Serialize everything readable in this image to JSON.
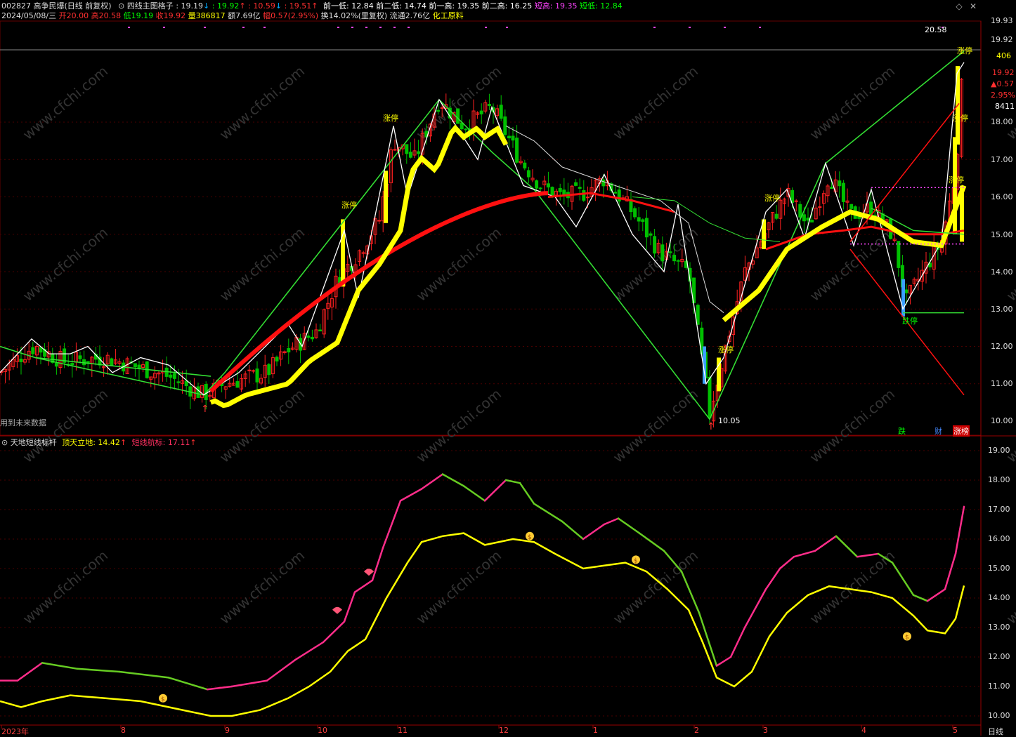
{
  "header1": {
    "code": "002827",
    "name": "高争民爆",
    "mode": "(日线 前复权)",
    "indicator": "四线主图格子",
    "v1": "19.19",
    "v1_arrow": "↓",
    "v2": "19.92",
    "v2_arrow": "↑",
    "v3": "10.59",
    "v3_arrow": "↓",
    "v4": "19.51",
    "v4_arrow": "↑",
    "prev_low1": "前一低: 12.84",
    "prev_low2": "前二低: 14.74",
    "prev_high1": "前一高: 19.35",
    "prev_high2": "前二高: 16.25",
    "short_high": "短高: 19.35",
    "short_low": "短低: 12.84"
  },
  "header2": {
    "date": "2024/05/08/三",
    "open": "开20.00",
    "high": "高20.58",
    "low": "低19.19",
    "close": "收19.92",
    "volume": "量386817",
    "amount": "额7.69亿",
    "change": "幅0.57(2.95%)",
    "turnover": "换14.02%(里复权)",
    "float": "流通2.76亿",
    "industry": "化工原料"
  },
  "main_chart": {
    "price_labels": [
      "19.93",
      "19.92",
      "18.00",
      "17.00",
      "16.00",
      "15.00",
      "14.00",
      "13.00",
      "12.00",
      "11.00",
      "10.00"
    ],
    "side_info": {
      "vol": "406",
      "price": "19.92",
      "change": "▲0.57",
      "pct": "2.95%",
      "vol2": "8411"
    },
    "high_marker": "20.58",
    "low_marker": "10.05",
    "zt_label": "涨停",
    "dt_label": "跌停",
    "note": "用到未来数据",
    "bottom_tags": [
      "跌",
      "财",
      "涨榜"
    ],
    "colors": {
      "up": "#ff2020",
      "down": "#00c000",
      "yellow": "#ffff00",
      "red_line": "#ff1010",
      "green_line": "#33cc33",
      "white": "#ffffff"
    }
  },
  "sub_chart": {
    "title": "天地短线标杆",
    "ding": "顶天立地: 14.42",
    "ding_arrow": "↑",
    "duan": "短线航标: 17.11",
    "duan_arrow": "↑",
    "price_labels": [
      "19.00",
      "18.00",
      "17.00",
      "16.00",
      "15.00",
      "14.00",
      "13.00",
      "12.00",
      "11.00",
      "10.00"
    ]
  },
  "x_axis": {
    "labels": [
      "2023年",
      "8",
      "9",
      "10",
      "11",
      "12",
      "1",
      "2",
      "3",
      "4",
      "5"
    ],
    "period": "日线"
  },
  "chart_data": {
    "type": "line",
    "x": [
      "2023-07",
      "2023-08",
      "2023-09",
      "2023-10",
      "2023-11",
      "2023-12",
      "2024-01",
      "2024-02",
      "2024-03",
      "2024-04",
      "2024-05"
    ],
    "series": [
      {
        "name": "短线航标",
        "values": [
          11.2,
          11.6,
          11.1,
          12.8,
          17.9,
          17.9,
          16.5,
          11.8,
          15.4,
          15.3,
          17.1
        ]
      },
      {
        "name": "顶天立地",
        "values": [
          10.3,
          10.5,
          10.0,
          11.5,
          16.3,
          16.0,
          15.0,
          11.2,
          14.2,
          14.1,
          14.4
        ]
      }
    ],
    "ylim": [
      9.8,
      19.2
    ],
    "close_prices": [
      11.5,
      11.2,
      11.0,
      14.9,
      18.2,
      16.3,
      16.5,
      10.6,
      15.1,
      15.0,
      19.9
    ]
  }
}
